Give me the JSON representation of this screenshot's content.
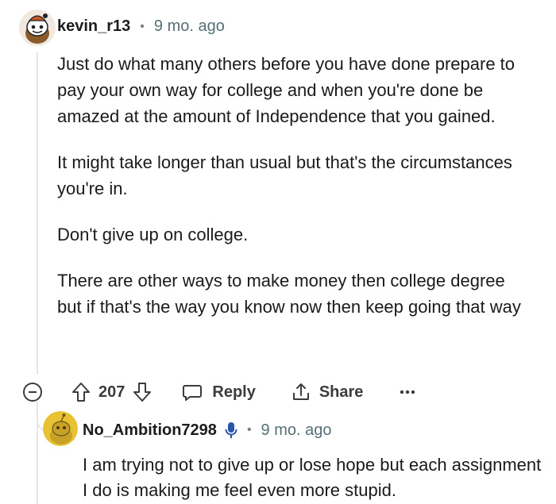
{
  "comment": {
    "username": "kevin_r13",
    "time": "9 mo. ago",
    "paragraphs": [
      "Just do what many others before you have done prepare to pay your own way for college and when you're done be amazed at the amount of Independence that you gained.",
      "It might take longer than usual but that's the circumstances you're in.",
      "Don't give up on college.",
      "There are other ways to make money then college degree but if that's the way you know now then keep going that way"
    ],
    "votes": "207",
    "reply_label": "Reply",
    "share_label": "Share"
  },
  "reply": {
    "username": "No_Ambition7298",
    "time": "9 mo. ago",
    "text": "I am trying not to give up or lose hope but each assignment I do is making me feel even more stupid."
  },
  "colors": {
    "text": "#1a1a1b",
    "meta": "#576f76",
    "mic": "#2b55a8",
    "reply_avatar": "#e8c232"
  },
  "icons": [
    "snoo-avatar-icon",
    "collapse-icon",
    "upvote-icon",
    "downvote-icon",
    "reply-icon",
    "share-icon",
    "more-icon",
    "microphone-icon",
    "snoo-avatar-yellow-icon"
  ]
}
